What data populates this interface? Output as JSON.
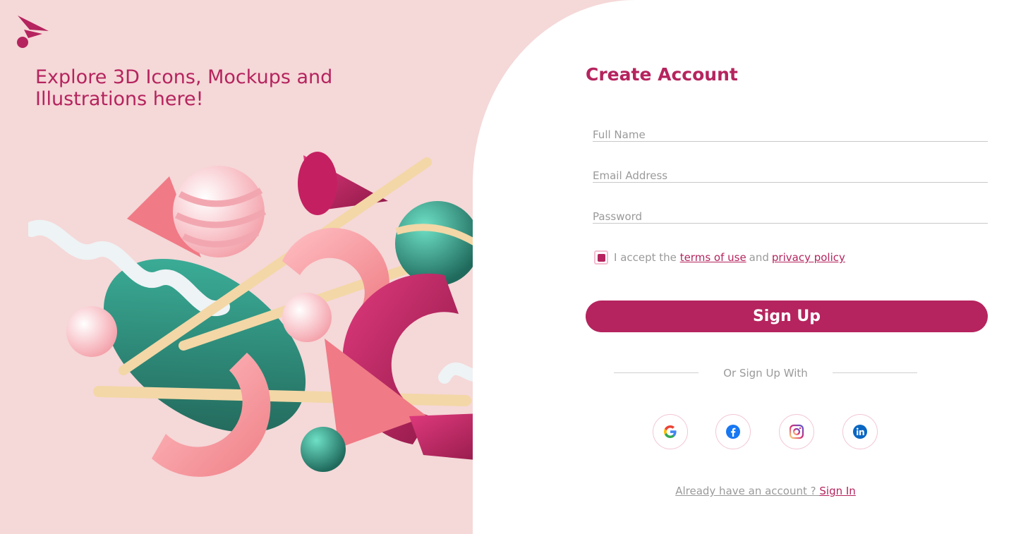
{
  "brand": {
    "logo": "paper-plane-logo",
    "color": "#b5245e"
  },
  "hero": {
    "tagline": "Explore 3D Icons, Mockups and Illustrations here!",
    "illustration": "abstract 3d shapes illustration"
  },
  "form": {
    "title": "Create Account",
    "fields": {
      "full_name": {
        "placeholder": "Full Name",
        "value": ""
      },
      "email": {
        "placeholder": "Email Address",
        "value": ""
      },
      "password": {
        "placeholder": "Password",
        "value": ""
      }
    },
    "terms": {
      "checked": true,
      "prefix": "I accept the",
      "terms_link": "terms of use",
      "conjunction": "and",
      "privacy_link": "privacy policy"
    },
    "submit_label": "Sign Up",
    "divider_label": "Or Sign Up With",
    "social": [
      {
        "name": "google",
        "icon": "google-icon"
      },
      {
        "name": "facebook",
        "icon": "facebook-icon"
      },
      {
        "name": "instagram",
        "icon": "instagram-icon"
      },
      {
        "name": "linkedin",
        "icon": "linkedin-icon"
      }
    ],
    "signin": {
      "prompt": "Already have an account ?",
      "link": "Sign In"
    }
  },
  "colors": {
    "accent": "#b5245e",
    "left_bg": "#f5d8d8",
    "muted_text": "#9a9a9a"
  }
}
